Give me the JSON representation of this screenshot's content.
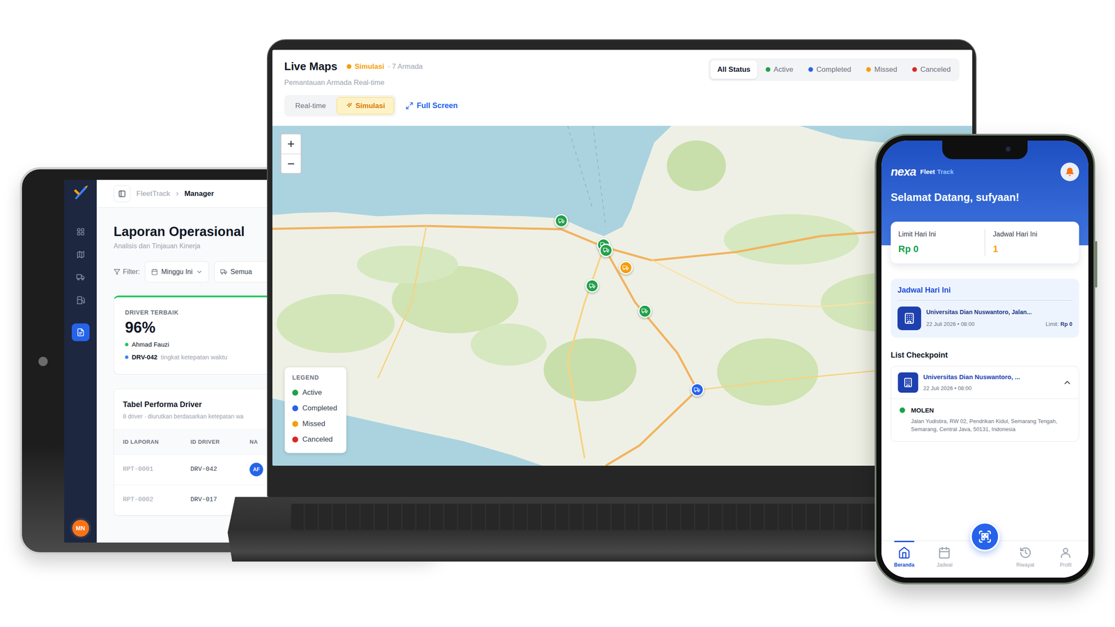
{
  "tablet": {
    "sidebar": {
      "items": [
        {
          "selected": false
        },
        {
          "selected": false
        },
        {
          "selected": false
        },
        {
          "selected": false
        },
        {
          "selected": true
        }
      ],
      "avatar": "MN"
    },
    "breadcrumb": [
      "FleetTrack",
      "Manager"
    ],
    "title": "Laporan Operasional",
    "subtitle": "Analisis dan Tinjauan Kinerja",
    "filter": {
      "label": "Filter:",
      "period": "Minggu Ini",
      "fleet": "Semua"
    },
    "best_driver": {
      "label": "DRIVER TERBAIK",
      "value": "96%",
      "name": "Ahmad Fauzi",
      "id": "DRV-042",
      "note": "tingkat ketepatan waktu"
    },
    "table": {
      "title": "Tabel Performa Driver",
      "subtitle": "8 driver · diurutkan berdasarkan ketepatan wa",
      "columns": [
        "ID LAPORAN",
        "ID DRIVER",
        "NA"
      ],
      "rows": [
        {
          "cells": [
            "RPT-0001",
            "DRV-042"
          ],
          "avatar": "AF"
        },
        {
          "cells": [
            "RPT-0002",
            "DRV-017"
          ]
        }
      ]
    }
  },
  "laptop": {
    "title": "Live Maps",
    "subtitle": "Pemantauan Armada Real-time",
    "mode_badge": "Simulasi",
    "count": "· 7 Armada",
    "status_filters": [
      {
        "label": "All Status",
        "selected": true
      },
      {
        "label": "Active",
        "color": "#22a04b",
        "selected": false
      },
      {
        "label": "Completed",
        "color": "#2563eb",
        "selected": false
      },
      {
        "label": "Missed",
        "color": "#f59e0b",
        "selected": false
      },
      {
        "label": "Canceled",
        "color": "#dc2626",
        "selected": false
      }
    ],
    "modes": [
      {
        "label": "Real-time",
        "selected": false
      },
      {
        "label": "Simulasi",
        "selected": true
      }
    ],
    "full_screen": "Full Screen",
    "zoom": [
      "+",
      "−"
    ],
    "legend": {
      "title": "LEGEND",
      "items": [
        {
          "label": "Active",
          "color": "#22a04b"
        },
        {
          "label": "Completed",
          "color": "#2563eb"
        },
        {
          "label": "Missed",
          "color": "#f59e0b"
        },
        {
          "label": "Canceled",
          "color": "#dc2626"
        }
      ]
    },
    "pins": [
      {
        "color": "#22a04b"
      },
      {
        "color": "#22a04b"
      },
      {
        "color": "#22a04b"
      },
      {
        "color": "#f59e0b"
      },
      {
        "color": "#22a04b"
      },
      {
        "color": "#22a04b"
      },
      {
        "color": "#2563eb"
      }
    ]
  },
  "phone": {
    "logo": "nexa",
    "app_name": [
      "Fleet",
      "Track"
    ],
    "greeting": "Selamat Datang, sufyaan!",
    "summary": [
      {
        "label": "Limit Hari Ini",
        "value": "Rp 0",
        "color": "#16a34a"
      },
      {
        "label": "Jadwal Hari Ini",
        "value": "1",
        "color": "#f59e0b"
      }
    ],
    "today": {
      "title": "Jadwal Hari Ini",
      "place": "Universitas Dian Nuswantoro, Jalan...",
      "date": "22 Juli 2026 • 08:00",
      "limit_label": "Limit:",
      "limit_value": "Rp 0"
    },
    "checkpoints_title": "List Checkpoint",
    "checkpoint": {
      "place": "Universitas Dian Nuswantoro, ...",
      "date": "22 Juli 2026 • 08:00",
      "expanded": true,
      "stops": [
        {
          "name": "MOLEN",
          "address": "Jalan Yudistira, RW 02, Pendrikan Kidul, Semarang Tengah, Semarang, Central Java, 50131, Indonesia",
          "color": "#16a34a"
        }
      ]
    },
    "nav": [
      {
        "label": "Beranda",
        "selected": true
      },
      {
        "label": "Jadwal",
        "selected": false
      },
      {
        "label": "Riwayat",
        "selected": false
      },
      {
        "label": "Profil",
        "selected": false
      }
    ]
  }
}
